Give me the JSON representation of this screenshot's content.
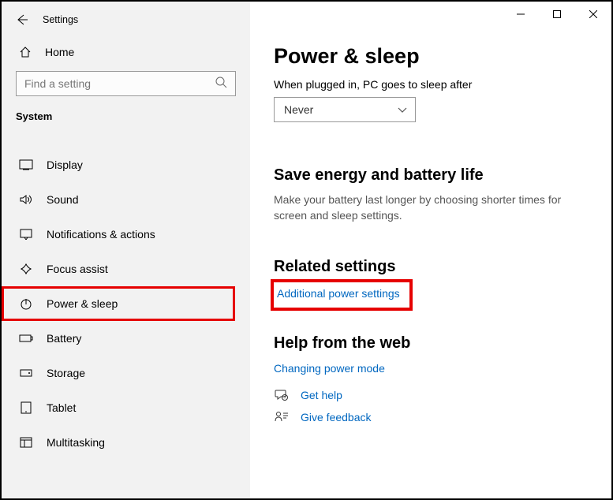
{
  "window_title": "Settings",
  "home_label": "Home",
  "search_placeholder": "Find a setting",
  "section_title": "System",
  "nav": {
    "items": [
      {
        "label": "Display"
      },
      {
        "label": "Sound"
      },
      {
        "label": "Notifications & actions"
      },
      {
        "label": "Focus assist"
      },
      {
        "label": "Power & sleep"
      },
      {
        "label": "Battery"
      },
      {
        "label": "Storage"
      },
      {
        "label": "Tablet"
      },
      {
        "label": "Multitasking"
      }
    ]
  },
  "main": {
    "title": "Power & sleep",
    "sleep_label": "When plugged in, PC goes to sleep after",
    "sleep_value": "Never",
    "energy_title": "Save energy and battery life",
    "energy_desc": "Make your battery last longer by choosing shorter times for screen and sleep settings.",
    "related_title": "Related settings",
    "related_link": "Additional power settings",
    "help_title": "Help from the web",
    "help_link": "Changing power mode",
    "get_help": "Get help",
    "give_feedback": "Give feedback"
  }
}
